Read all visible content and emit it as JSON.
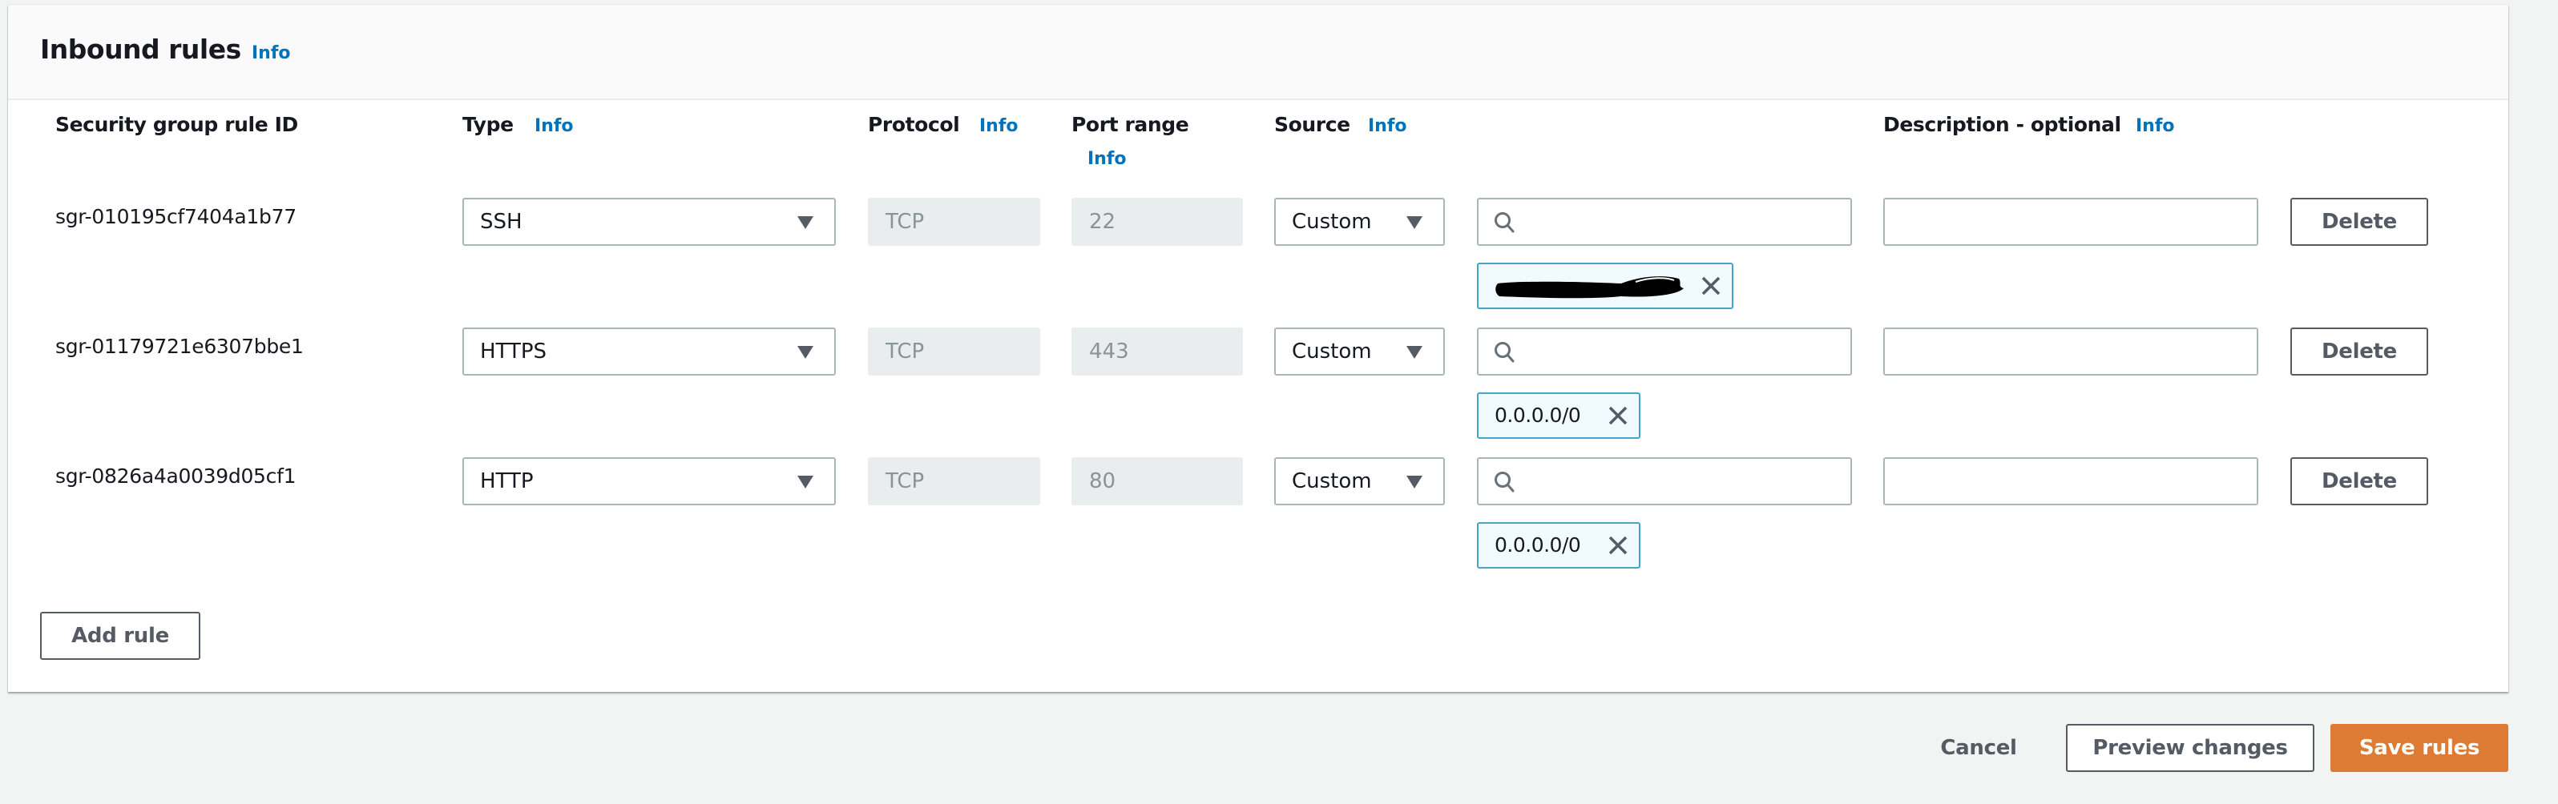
{
  "panel": {
    "title": "Inbound rules",
    "title_info": "Info"
  },
  "columns": {
    "rule_id": "Security group rule ID",
    "type": "Type",
    "type_info": "Info",
    "protocol": "Protocol",
    "protocol_info": "Info",
    "port_range": "Port range",
    "port_range_info": "Info",
    "source": "Source",
    "source_info": "Info",
    "description": "Description - optional",
    "description_info": "Info"
  },
  "rules": [
    {
      "id": "sgr-010195cf7404a1b77",
      "type": "SSH",
      "protocol": "TCP",
      "port_range": "22",
      "source_type": "Custom",
      "source_search": "",
      "source_chip": "[redacted]",
      "source_chip_redacted": true,
      "description": "",
      "delete_label": "Delete"
    },
    {
      "id": "sgr-01179721e6307bbe1",
      "type": "HTTPS",
      "protocol": "TCP",
      "port_range": "443",
      "source_type": "Custom",
      "source_search": "",
      "source_chip": "0.0.0.0/0",
      "source_chip_redacted": false,
      "description": "",
      "delete_label": "Delete"
    },
    {
      "id": "sgr-0826a4a0039d05cf1",
      "type": "HTTP",
      "protocol": "TCP",
      "port_range": "80",
      "source_type": "Custom",
      "source_search": "",
      "source_chip": "0.0.0.0/0",
      "source_chip_redacted": false,
      "description": "",
      "delete_label": "Delete"
    }
  ],
  "actions": {
    "add_rule": "Add rule",
    "cancel": "Cancel",
    "preview_changes": "Preview changes",
    "save_rules": "Save rules"
  },
  "colors": {
    "accent_link": "#0073bb",
    "primary_button": "#dd7a33",
    "chip_border": "#4aa3c7",
    "chip_background": "#f1faff",
    "page_background": "#f2f3f3"
  }
}
